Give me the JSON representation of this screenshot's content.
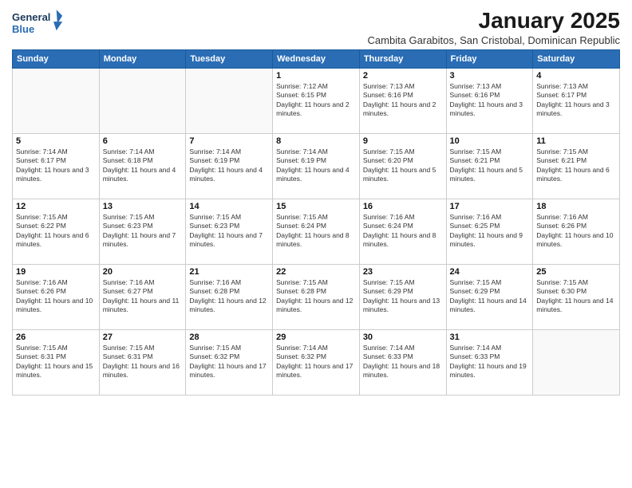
{
  "logo": {
    "line1": "General",
    "line2": "Blue"
  },
  "title": "January 2025",
  "subtitle": "Cambita Garabitos, San Cristobal, Dominican Republic",
  "days_of_week": [
    "Sunday",
    "Monday",
    "Tuesday",
    "Wednesday",
    "Thursday",
    "Friday",
    "Saturday"
  ],
  "weeks": [
    [
      {
        "day": "",
        "info": ""
      },
      {
        "day": "",
        "info": ""
      },
      {
        "day": "",
        "info": ""
      },
      {
        "day": "1",
        "info": "Sunrise: 7:12 AM\nSunset: 6:15 PM\nDaylight: 11 hours and 2 minutes."
      },
      {
        "day": "2",
        "info": "Sunrise: 7:13 AM\nSunset: 6:16 PM\nDaylight: 11 hours and 2 minutes."
      },
      {
        "day": "3",
        "info": "Sunrise: 7:13 AM\nSunset: 6:16 PM\nDaylight: 11 hours and 3 minutes."
      },
      {
        "day": "4",
        "info": "Sunrise: 7:13 AM\nSunset: 6:17 PM\nDaylight: 11 hours and 3 minutes."
      }
    ],
    [
      {
        "day": "5",
        "info": "Sunrise: 7:14 AM\nSunset: 6:17 PM\nDaylight: 11 hours and 3 minutes."
      },
      {
        "day": "6",
        "info": "Sunrise: 7:14 AM\nSunset: 6:18 PM\nDaylight: 11 hours and 4 minutes."
      },
      {
        "day": "7",
        "info": "Sunrise: 7:14 AM\nSunset: 6:19 PM\nDaylight: 11 hours and 4 minutes."
      },
      {
        "day": "8",
        "info": "Sunrise: 7:14 AM\nSunset: 6:19 PM\nDaylight: 11 hours and 4 minutes."
      },
      {
        "day": "9",
        "info": "Sunrise: 7:15 AM\nSunset: 6:20 PM\nDaylight: 11 hours and 5 minutes."
      },
      {
        "day": "10",
        "info": "Sunrise: 7:15 AM\nSunset: 6:21 PM\nDaylight: 11 hours and 5 minutes."
      },
      {
        "day": "11",
        "info": "Sunrise: 7:15 AM\nSunset: 6:21 PM\nDaylight: 11 hours and 6 minutes."
      }
    ],
    [
      {
        "day": "12",
        "info": "Sunrise: 7:15 AM\nSunset: 6:22 PM\nDaylight: 11 hours and 6 minutes."
      },
      {
        "day": "13",
        "info": "Sunrise: 7:15 AM\nSunset: 6:23 PM\nDaylight: 11 hours and 7 minutes."
      },
      {
        "day": "14",
        "info": "Sunrise: 7:15 AM\nSunset: 6:23 PM\nDaylight: 11 hours and 7 minutes."
      },
      {
        "day": "15",
        "info": "Sunrise: 7:15 AM\nSunset: 6:24 PM\nDaylight: 11 hours and 8 minutes."
      },
      {
        "day": "16",
        "info": "Sunrise: 7:16 AM\nSunset: 6:24 PM\nDaylight: 11 hours and 8 minutes."
      },
      {
        "day": "17",
        "info": "Sunrise: 7:16 AM\nSunset: 6:25 PM\nDaylight: 11 hours and 9 minutes."
      },
      {
        "day": "18",
        "info": "Sunrise: 7:16 AM\nSunset: 6:26 PM\nDaylight: 11 hours and 10 minutes."
      }
    ],
    [
      {
        "day": "19",
        "info": "Sunrise: 7:16 AM\nSunset: 6:26 PM\nDaylight: 11 hours and 10 minutes."
      },
      {
        "day": "20",
        "info": "Sunrise: 7:16 AM\nSunset: 6:27 PM\nDaylight: 11 hours and 11 minutes."
      },
      {
        "day": "21",
        "info": "Sunrise: 7:16 AM\nSunset: 6:28 PM\nDaylight: 11 hours and 12 minutes."
      },
      {
        "day": "22",
        "info": "Sunrise: 7:15 AM\nSunset: 6:28 PM\nDaylight: 11 hours and 12 minutes."
      },
      {
        "day": "23",
        "info": "Sunrise: 7:15 AM\nSunset: 6:29 PM\nDaylight: 11 hours and 13 minutes."
      },
      {
        "day": "24",
        "info": "Sunrise: 7:15 AM\nSunset: 6:29 PM\nDaylight: 11 hours and 14 minutes."
      },
      {
        "day": "25",
        "info": "Sunrise: 7:15 AM\nSunset: 6:30 PM\nDaylight: 11 hours and 14 minutes."
      }
    ],
    [
      {
        "day": "26",
        "info": "Sunrise: 7:15 AM\nSunset: 6:31 PM\nDaylight: 11 hours and 15 minutes."
      },
      {
        "day": "27",
        "info": "Sunrise: 7:15 AM\nSunset: 6:31 PM\nDaylight: 11 hours and 16 minutes."
      },
      {
        "day": "28",
        "info": "Sunrise: 7:15 AM\nSunset: 6:32 PM\nDaylight: 11 hours and 17 minutes."
      },
      {
        "day": "29",
        "info": "Sunrise: 7:14 AM\nSunset: 6:32 PM\nDaylight: 11 hours and 17 minutes."
      },
      {
        "day": "30",
        "info": "Sunrise: 7:14 AM\nSunset: 6:33 PM\nDaylight: 11 hours and 18 minutes."
      },
      {
        "day": "31",
        "info": "Sunrise: 7:14 AM\nSunset: 6:33 PM\nDaylight: 11 hours and 19 minutes."
      },
      {
        "day": "",
        "info": ""
      }
    ]
  ]
}
